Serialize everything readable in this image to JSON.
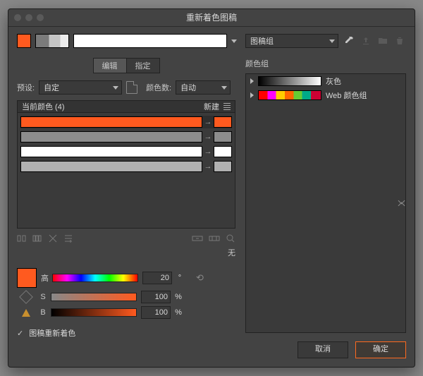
{
  "window": {
    "title": "重新着色图稿"
  },
  "topbar": {
    "group_dropdown": "图稿组",
    "eyedropper_name": "eyedropper",
    "upload_name": "upload",
    "folder_name": "folder",
    "trash_name": "trash"
  },
  "tabs": {
    "edit": "编辑",
    "assign": "指定",
    "active": "edit"
  },
  "preset": {
    "label": "预设:",
    "value": "自定",
    "colors_label": "颜色数:",
    "colors_value": "自动"
  },
  "list": {
    "header_current": "当前颜色 (4)",
    "header_new": "新建",
    "rows": [
      {
        "bar": "#ff5a1f",
        "chip": "#ff5a1f",
        "selected": true
      },
      {
        "bar": "#8d8d8d",
        "chip": "#8d8d8d",
        "selected": false
      },
      {
        "bar": "#ffffff",
        "chip": "#ffffff",
        "selected": false
      },
      {
        "bar": "#b0b0b0",
        "chip": "#b0b0b0",
        "selected": false
      }
    ]
  },
  "none_label": "无",
  "hsb": {
    "h_label": "高",
    "h_value": "20",
    "s_label": "S",
    "s_value": "100",
    "s_unit": "%",
    "b_label": "B",
    "b_value": "100",
    "b_unit": "%",
    "swatch": "#ff5a1f"
  },
  "groups": {
    "title": "颜色组",
    "items": [
      {
        "name": "灰色",
        "swatch_css": "linear-gradient(90deg,#000,#333,#666,#999,#ccc,#fff)",
        "width": 88
      },
      {
        "name": "Web 颜色组",
        "swatch_css": "linear-gradient(90deg,#ff0000 0 14%,#ff00ff 14% 28%,#ffcc00 28% 42%,#ff6600 42% 56%,#66cc33 56% 70%,#00aa88 70% 84%,#cc0033 84% 100%)",
        "width": 88
      }
    ]
  },
  "checkbox": {
    "label": "图稿重新着色",
    "checked": true
  },
  "buttons": {
    "cancel": "取消",
    "ok": "确定"
  }
}
